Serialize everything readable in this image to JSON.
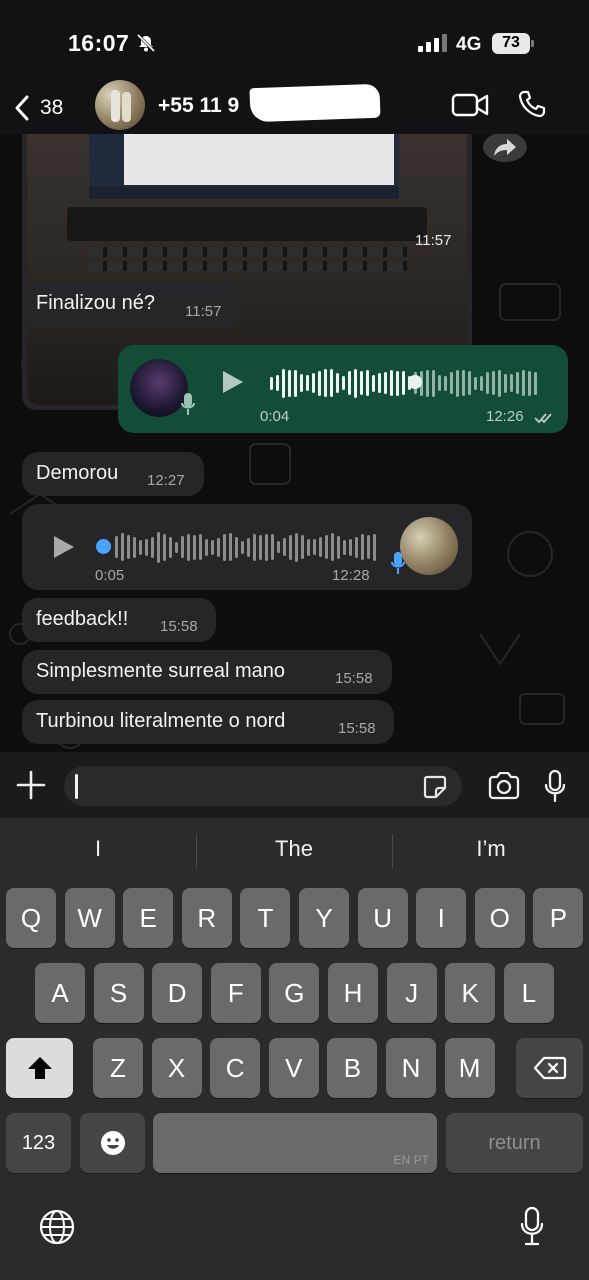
{
  "status_bar": {
    "time": "16:07",
    "network": "4G",
    "battery": "73"
  },
  "header": {
    "back_count": "38",
    "contact": "+55 11 9"
  },
  "messages": [
    {
      "type": "image",
      "time": "11:57"
    },
    {
      "type": "text",
      "direction": "in",
      "text": "Finalizou né?",
      "time": "11:57"
    },
    {
      "type": "voice",
      "direction": "out",
      "duration": "0:04",
      "time": "12:26",
      "status": "read",
      "progress": 0.52
    },
    {
      "type": "text",
      "direction": "in",
      "text": "Demorou",
      "time": "12:27"
    },
    {
      "type": "voice",
      "direction": "in",
      "duration": "0:05",
      "time": "12:28",
      "progress": 0.0
    },
    {
      "type": "text",
      "direction": "in",
      "text": "feedback!!",
      "time": "15:58"
    },
    {
      "type": "text",
      "direction": "in",
      "text": "Simplesmente surreal mano",
      "time": "15:58"
    },
    {
      "type": "text",
      "direction": "in",
      "text": "Turbinou literalmente o nord",
      "time": "15:58"
    }
  ],
  "input": {
    "value": ""
  },
  "keyboard": {
    "suggestions": [
      "I",
      "The",
      "I’m"
    ],
    "row1": [
      "Q",
      "W",
      "E",
      "R",
      "T",
      "Y",
      "U",
      "I",
      "O",
      "P"
    ],
    "row2": [
      "A",
      "S",
      "D",
      "F",
      "G",
      "H",
      "J",
      "K",
      "L"
    ],
    "row3": [
      "Z",
      "X",
      "C",
      "V",
      "B",
      "N",
      "M"
    ],
    "numbers_label": "123",
    "space_label": "EN PT",
    "return_label": "return"
  },
  "colors": {
    "outgoing_bubble": "#144d37",
    "incoming_bubble": "#262628",
    "accent_blue": "#4aa3ff",
    "background": "#0d0d0e"
  }
}
